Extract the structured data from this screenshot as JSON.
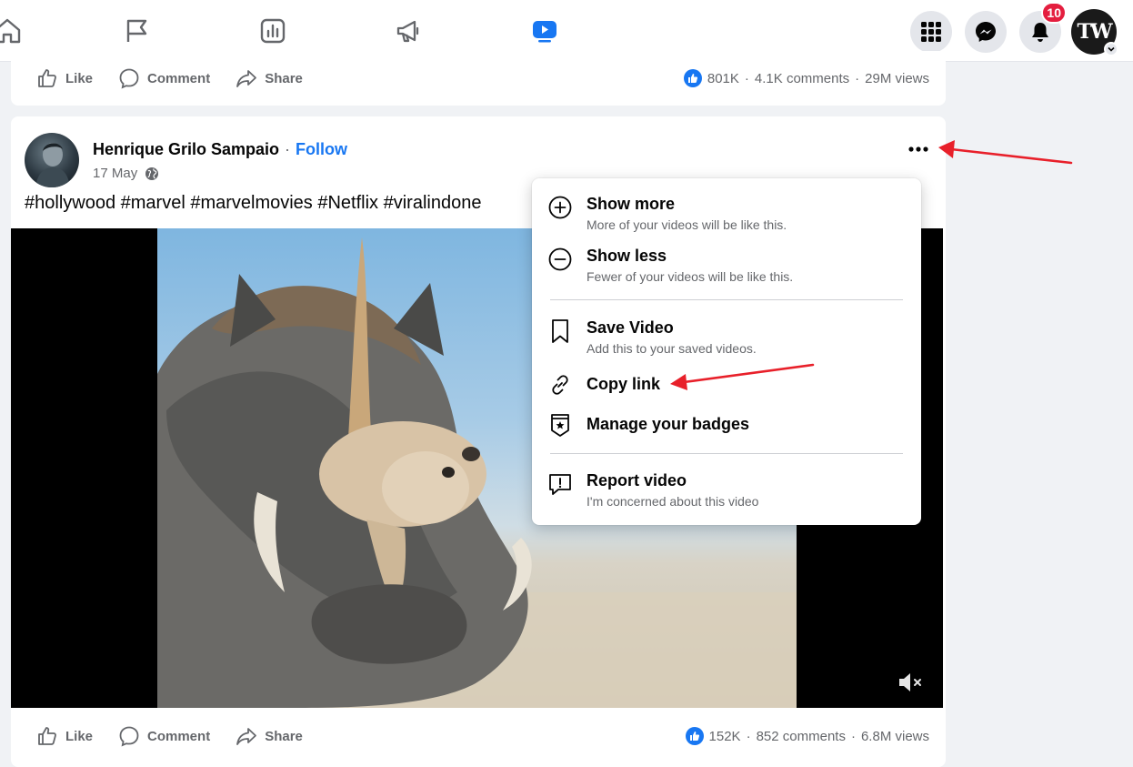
{
  "top_bar": {
    "notifications_count": "10",
    "profile_initials": "TW"
  },
  "previous_post": {
    "actions": {
      "like": "Like",
      "comment": "Comment",
      "share": "Share"
    },
    "stats": {
      "reactions": "801K",
      "comments": "4.1K comments",
      "views": "29M views"
    }
  },
  "post": {
    "author": "Henrique Grilo Sampaio",
    "separator": "·",
    "follow": "Follow",
    "date": "17 May",
    "text": "#hollywood #marvel #marvelmovies #Netflix #viralindone",
    "actions": {
      "like": "Like",
      "comment": "Comment",
      "share": "Share"
    },
    "stats": {
      "reactions": "152K",
      "comments": "852 comments",
      "views": "6.8M views"
    },
    "stats_separator": "·"
  },
  "menu": {
    "items": [
      {
        "title": "Show more",
        "subtitle": "More of your videos will be like this.",
        "icon": "plus-circle-icon"
      },
      {
        "title": "Show less",
        "subtitle": "Fewer of your videos will be like this.",
        "icon": "minus-circle-icon"
      },
      {
        "title": "Save Video",
        "subtitle": "Add this to your saved videos.",
        "icon": "bookmark-icon"
      },
      {
        "title": "Copy link",
        "subtitle": "",
        "icon": "link-icon"
      },
      {
        "title": "Manage your badges",
        "subtitle": "",
        "icon": "badge-icon"
      },
      {
        "title": "Report video",
        "subtitle": "I'm concerned about this video",
        "icon": "report-icon"
      }
    ]
  },
  "colors": {
    "accent": "#1877f2",
    "badge": "#e41e3f",
    "annotation_arrow": "#e8202a",
    "secondary_text": "#65676b"
  }
}
